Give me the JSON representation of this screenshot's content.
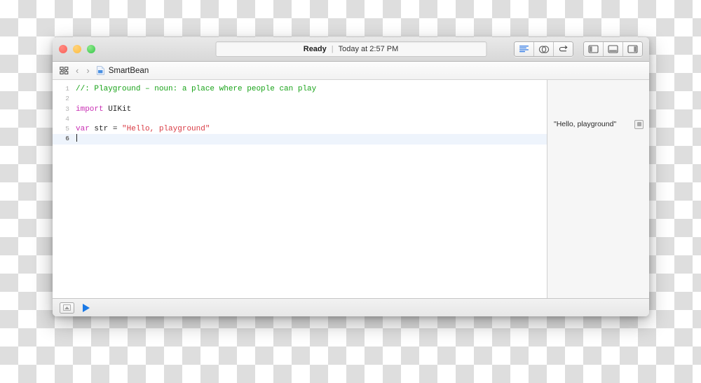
{
  "window": {
    "titlebar": {
      "traffic_lights": [
        {
          "name": "close",
          "color": "#fb6058"
        },
        {
          "name": "minimize",
          "color": "#fdbc40"
        },
        {
          "name": "zoom",
          "color": "#34c749"
        }
      ],
      "status": {
        "state": "Ready",
        "separator": "|",
        "timestamp": "Today at 2:57 PM"
      },
      "editor_buttons": [
        {
          "name": "standard-editor-icon",
          "label": "Standard Editor"
        },
        {
          "name": "assistant-editor-icon",
          "label": "Assistant Editor"
        },
        {
          "name": "version-editor-icon",
          "label": "Version Editor"
        }
      ],
      "panel_buttons": [
        {
          "name": "toggle-navigator-icon",
          "label": "Navigator"
        },
        {
          "name": "toggle-debug-area-icon",
          "label": "Debug Area"
        },
        {
          "name": "toggle-utilities-icon",
          "label": "Utilities"
        }
      ]
    },
    "navbar": {
      "grid_icon": "related-items-icon",
      "back_label": "‹",
      "forward_label": "›",
      "file_icon": "playground-file-icon",
      "file_name": "SmartBean"
    },
    "editor": {
      "lines": [
        {
          "num": "1",
          "tokens": [
            {
              "t": "comment",
              "v": "//: Playground – noun: a place where people can play"
            }
          ]
        },
        {
          "num": "2",
          "tokens": []
        },
        {
          "num": "3",
          "tokens": [
            {
              "t": "kw",
              "v": "import"
            },
            {
              "t": "plain",
              "v": " UIKit"
            }
          ]
        },
        {
          "num": "4",
          "tokens": []
        },
        {
          "num": "5",
          "tokens": [
            {
              "t": "kw",
              "v": "var"
            },
            {
              "t": "plain",
              "v": " str = "
            },
            {
              "t": "str",
              "v": "\"Hello, playground\""
            }
          ]
        },
        {
          "num": "6",
          "tokens": [],
          "current": true,
          "caret": true
        }
      ],
      "colors": {
        "comment": "#18a318",
        "keyword": "#c930b4",
        "plain": "#262626",
        "string": "#d93a43",
        "current_line": "#eef4fc"
      }
    },
    "results": {
      "value": "\"Hello, playground\"",
      "quicklook_label": "Quick Look"
    },
    "bottombar": {
      "console_toggle_label": "Show Console",
      "run_label": "Execute Playground"
    }
  }
}
